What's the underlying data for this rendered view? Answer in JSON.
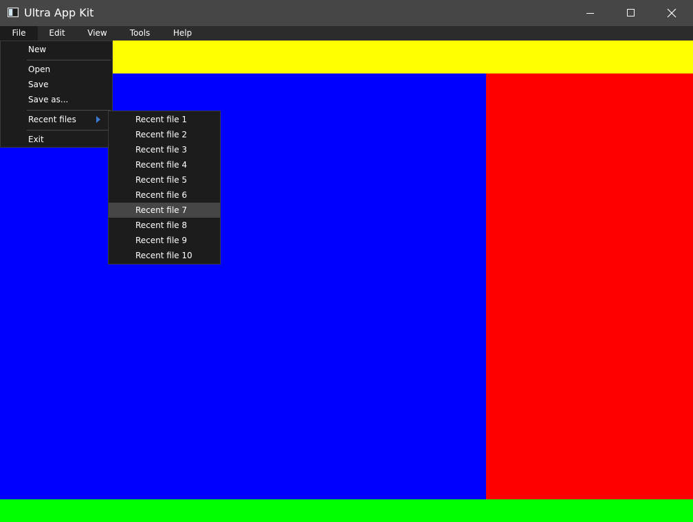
{
  "window": {
    "title": "Ultra App Kit",
    "icon": "app-window-icon",
    "controls": {
      "minimize_icon": "minimize-icon",
      "maximize_icon": "maximize-icon",
      "close_icon": "close-icon"
    }
  },
  "menubar": {
    "items": [
      {
        "label": "File",
        "active": true
      },
      {
        "label": "Edit",
        "active": false
      },
      {
        "label": "View",
        "active": false
      },
      {
        "label": "Tools",
        "active": false
      },
      {
        "label": "Help",
        "active": false
      }
    ]
  },
  "file_menu": {
    "items": [
      {
        "label": "New"
      },
      {
        "label": "Open"
      },
      {
        "label": "Save"
      },
      {
        "label": "Save as..."
      },
      {
        "label": "Recent files",
        "has_submenu": true
      },
      {
        "label": "Exit"
      }
    ]
  },
  "recent_files_menu": {
    "items": [
      {
        "label": "Recent file 1"
      },
      {
        "label": "Recent file 2"
      },
      {
        "label": "Recent file 3"
      },
      {
        "label": "Recent file 4"
      },
      {
        "label": "Recent file 5"
      },
      {
        "label": "Recent file 6"
      },
      {
        "label": "Recent file 7",
        "highlighted": true
      },
      {
        "label": "Recent file 8"
      },
      {
        "label": "Recent file 9"
      },
      {
        "label": "Recent file 10"
      }
    ]
  },
  "panels": {
    "top_color": "#ffff00",
    "left_color": "#0000ff",
    "right_color": "#ff0000",
    "bottom_color": "#00ff00"
  },
  "colors": {
    "titlebar_bg": "#464646",
    "menubar_bg": "#2c2c2c",
    "menu_bg": "#1c1c1c",
    "menu_highlight": "#464646",
    "submenu_arrow": "#3a7bd5"
  }
}
